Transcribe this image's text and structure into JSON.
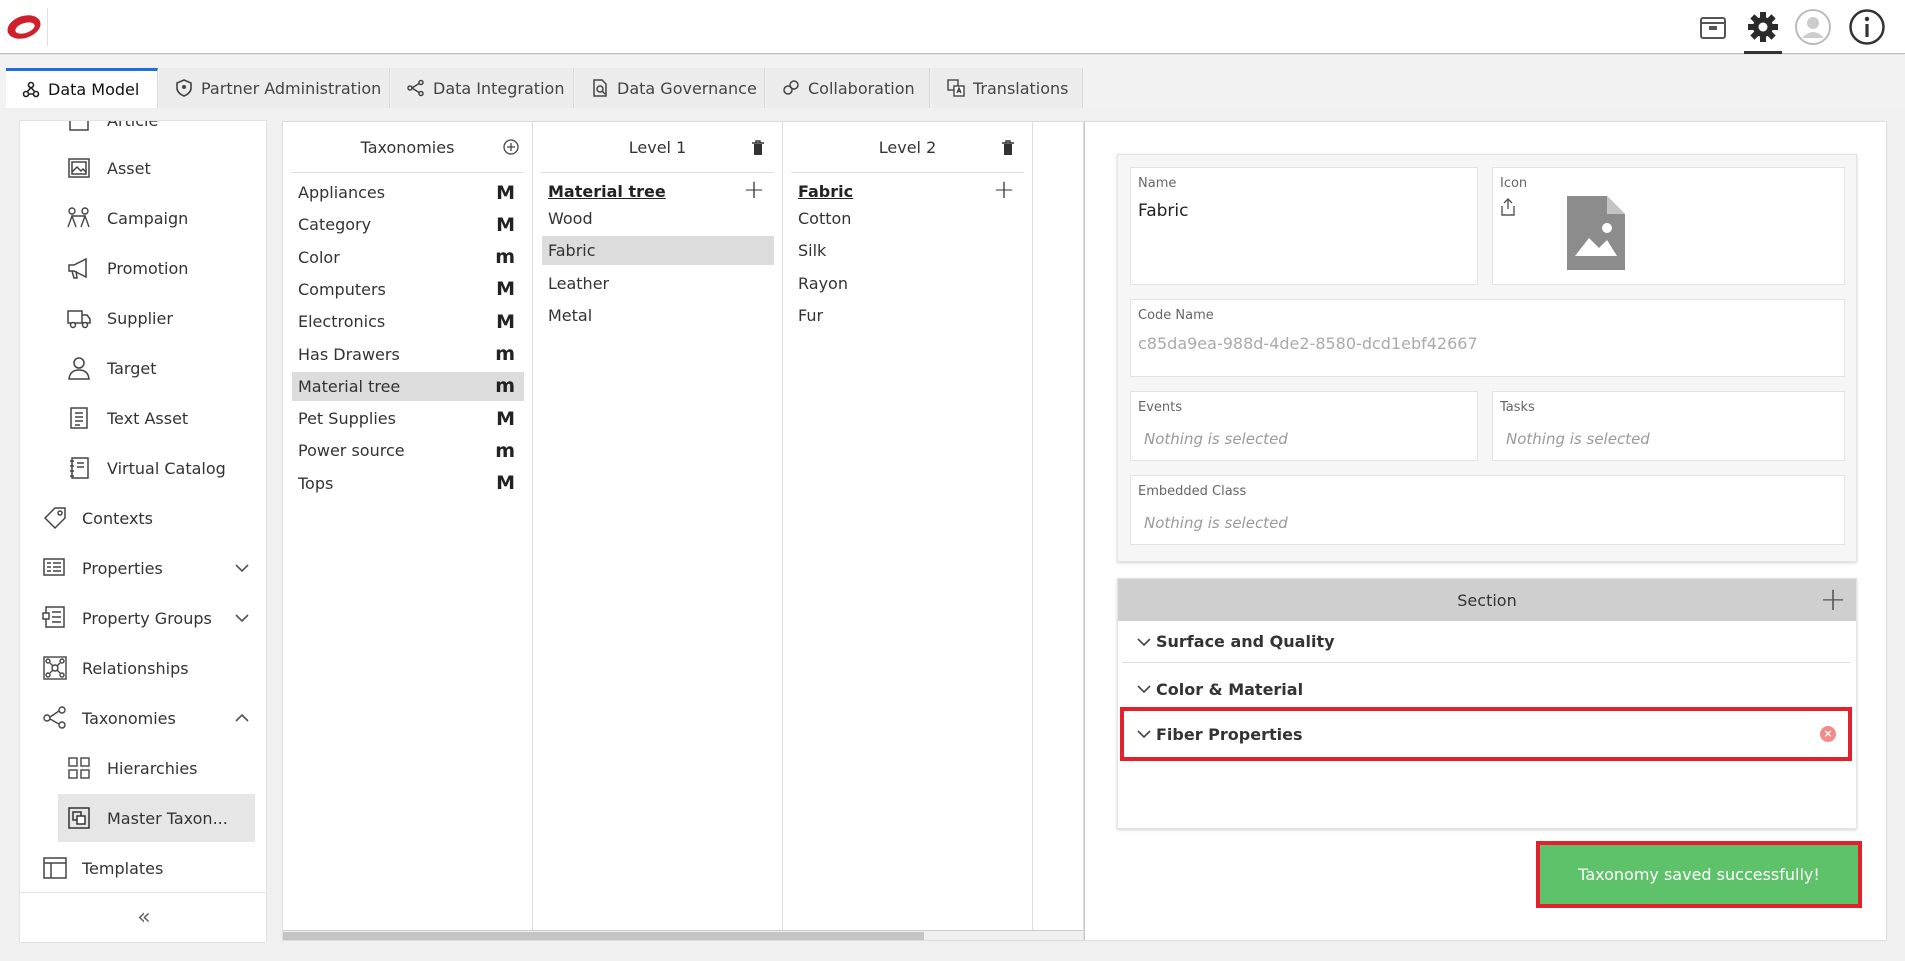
{
  "topbar": {
    "icons": [
      "logo",
      "package-icon",
      "gear-icon",
      "user-avatar-icon",
      "info-icon"
    ]
  },
  "tabs": [
    {
      "label": "Data Model",
      "icon": "data-model-icon",
      "active": true
    },
    {
      "label": "Partner Administration",
      "icon": "shield-icon"
    },
    {
      "label": "Data Integration",
      "icon": "integration-icon"
    },
    {
      "label": "Data Governance",
      "icon": "governance-icon"
    },
    {
      "label": "Collaboration",
      "icon": "collaboration-icon"
    },
    {
      "label": "Translations",
      "icon": "translations-icon"
    }
  ],
  "sidebar": {
    "items": [
      {
        "label": "Article",
        "icon": "article-icon"
      },
      {
        "label": "Asset",
        "icon": "asset-icon"
      },
      {
        "label": "Campaign",
        "icon": "campaign-icon"
      },
      {
        "label": "Promotion",
        "icon": "megaphone-icon"
      },
      {
        "label": "Supplier",
        "icon": "truck-icon"
      },
      {
        "label": "Target",
        "icon": "target-user-icon"
      },
      {
        "label": "Text Asset",
        "icon": "text-asset-icon"
      },
      {
        "label": "Virtual Catalog",
        "icon": "catalog-icon"
      },
      {
        "label": "Contexts",
        "icon": "tag-icon"
      },
      {
        "label": "Properties",
        "icon": "properties-icon",
        "expandable": "down"
      },
      {
        "label": "Property Groups",
        "icon": "property-groups-icon",
        "expandable": "down"
      },
      {
        "label": "Relationships",
        "icon": "relationships-icon"
      },
      {
        "label": "Taxonomies",
        "icon": "taxonomies-icon",
        "expandable": "up"
      },
      {
        "label": "Hierarchies",
        "icon": "hierarchies-icon"
      },
      {
        "label": "Master Taxon...",
        "icon": "master-taxonomy-icon",
        "selected": true
      },
      {
        "label": "Templates",
        "icon": "templates-icon"
      }
    ],
    "collapse_label": "«"
  },
  "taxonomies": {
    "header": "Taxonomies",
    "rows": [
      {
        "name": "Appliances",
        "type": "M"
      },
      {
        "name": "Category",
        "type": "M"
      },
      {
        "name": "Color",
        "type": "m"
      },
      {
        "name": "Computers",
        "type": "M"
      },
      {
        "name": "Electronics",
        "type": "M"
      },
      {
        "name": "Has Drawers",
        "type": "m"
      },
      {
        "name": "Material tree",
        "type": "m",
        "selected": true
      },
      {
        "name": "Pet Supplies",
        "type": "M"
      },
      {
        "name": "Power source",
        "type": "m"
      },
      {
        "name": "Tops",
        "type": "M"
      }
    ]
  },
  "level1": {
    "header": "Level 1",
    "title": "Material tree",
    "rows": [
      "Wood",
      "Fabric",
      "Leather",
      "Metal"
    ],
    "selected": "Fabric"
  },
  "level2": {
    "header": "Level 2",
    "title": "Fabric",
    "rows": [
      "Cotton",
      "Silk",
      "Rayon",
      "Fur"
    ]
  },
  "details": {
    "name_label": "Name",
    "name_value": "Fabric",
    "icon_label": "Icon",
    "code_label": "Code Name",
    "code_value": "c85da9ea-988d-4de2-8580-dcd1ebf42667",
    "events_label": "Events",
    "events_value": "Nothing is selected",
    "tasks_label": "Tasks",
    "tasks_value": "Nothing is selected",
    "embedded_label": "Embedded Class",
    "embedded_value": "Nothing is selected"
  },
  "section": {
    "header": "Section",
    "rows": [
      "Surface and Quality",
      "Color & Material",
      "Fiber Properties"
    ]
  },
  "toast": {
    "message": "Taxonomy saved successfully!",
    "color": "#5ec26a"
  },
  "colors": {
    "accent": "#1e6fd9",
    "highlight": "#e3202c",
    "selected_bg": "#dcdcdc"
  }
}
